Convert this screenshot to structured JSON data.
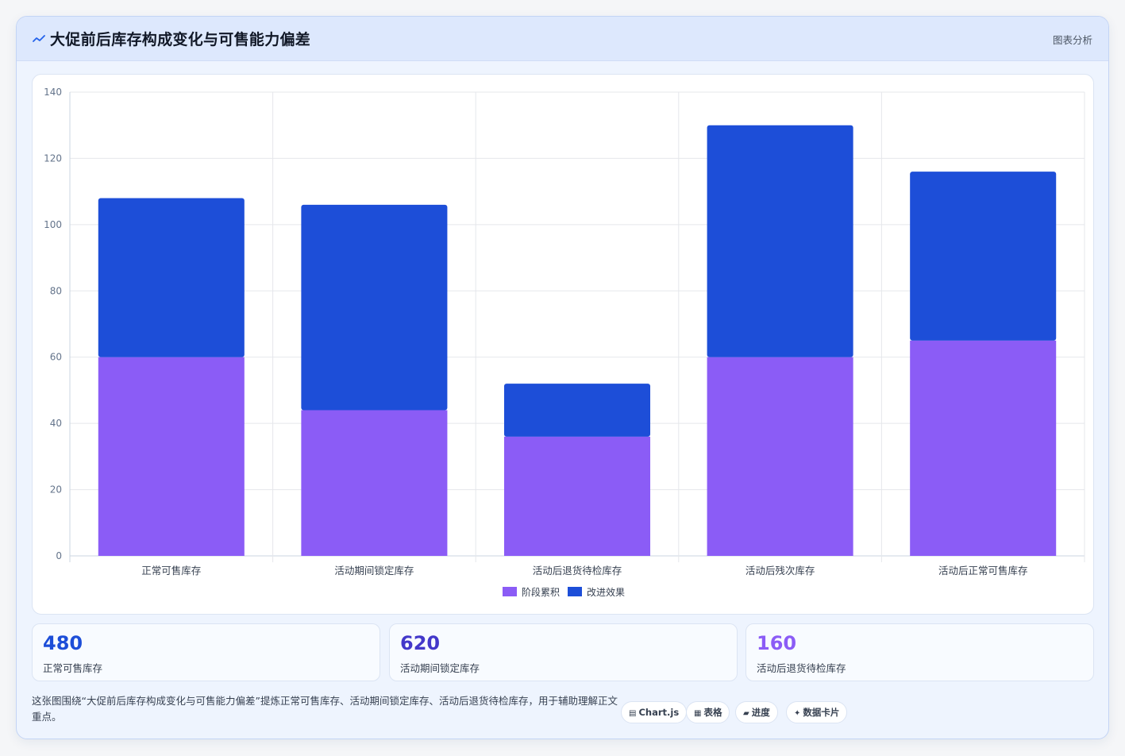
{
  "header": {
    "title": "大促前后库存构成变化与可售能力偏差",
    "tag": "图表分析",
    "icon": "line-chart-icon"
  },
  "chart_data": {
    "type": "bar",
    "stacked": true,
    "categories": [
      "正常可售库存",
      "活动期间锁定库存",
      "活动后退货待检库存",
      "活动后残次库存",
      "活动后正常可售库存"
    ],
    "series": [
      {
        "name": "阶段累积",
        "color": "#8b5cf6",
        "values": [
          60,
          44,
          36,
          60,
          65
        ]
      },
      {
        "name": "改进效果",
        "color": "#1d4ed8",
        "values": [
          48,
          62,
          16,
          70,
          51
        ]
      }
    ],
    "ylim": [
      0,
      140
    ],
    "yticks": [
      0,
      20,
      40,
      60,
      80,
      100,
      120,
      140
    ],
    "grid": true,
    "legend": "bottom"
  },
  "stats": [
    {
      "value": "480",
      "label": "正常可售库存",
      "color": "#1d4ed8"
    },
    {
      "value": "620",
      "label": "活动期间锁定库存",
      "color": "#4338ca"
    },
    {
      "value": "160",
      "label": "活动后退货待检库存",
      "color": "#8b5cf6"
    }
  ],
  "footer": {
    "text": "这张图围绕“大促前后库存构成变化与可售能力偏差”提炼正常可售库存、活动期间锁定库存、活动后退货待检库存，用于辅助理解正文重点。",
    "chips": [
      {
        "icon": "▤",
        "label": "Chart.js"
      },
      {
        "icon": "▦",
        "label": "表格"
      },
      {
        "icon": "▰",
        "label": "进度"
      },
      {
        "icon": "✦",
        "label": "数据卡片"
      }
    ]
  }
}
